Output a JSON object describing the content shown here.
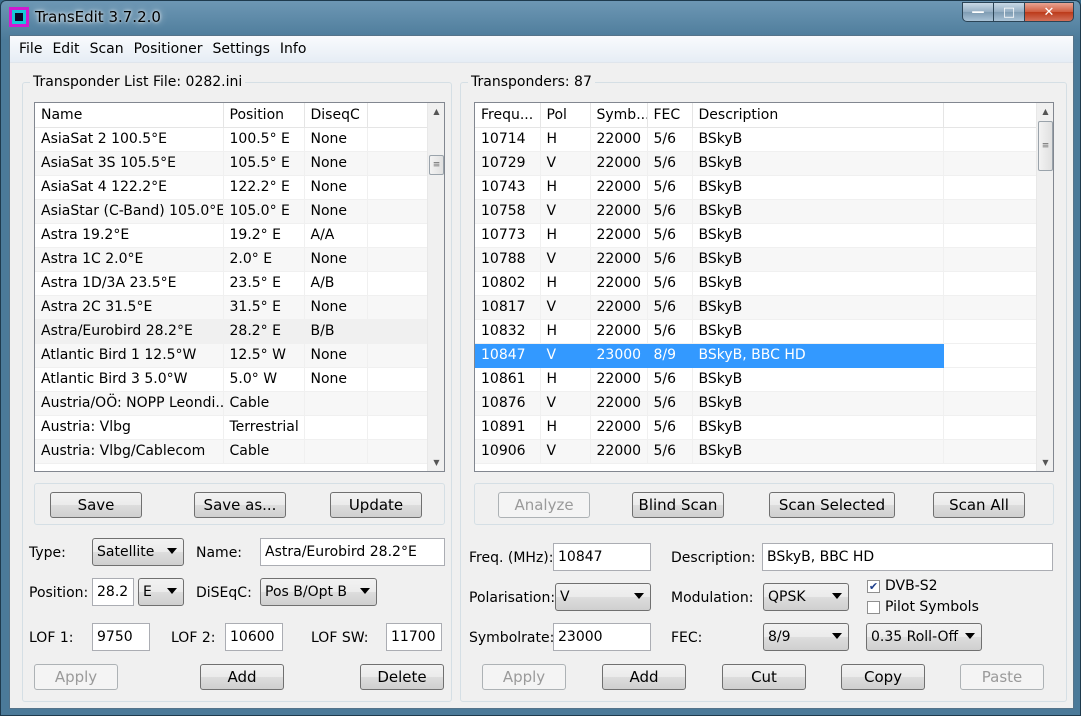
{
  "window": {
    "title": "TransEdit 3.7.2.0"
  },
  "menu": [
    "File",
    "Edit",
    "Scan",
    "Positioner",
    "Settings",
    "Info"
  ],
  "left": {
    "group_title": "Transponder List File:  0282.ini",
    "columns": [
      "Name",
      "Position",
      "DiseqC"
    ],
    "rows": [
      [
        "AsiaSat 2 100.5°E",
        "100.5° E",
        "None"
      ],
      [
        "AsiaSat 3S 105.5°E",
        "105.5° E",
        "None"
      ],
      [
        "AsiaSat 4 122.2°E",
        "122.2° E",
        "None"
      ],
      [
        "AsiaStar (C-Band) 105.0°E",
        "105.0° E",
        "None"
      ],
      [
        "Astra 19.2°E",
        "19.2° E",
        "A/A"
      ],
      [
        "Astra 1C 2.0°E",
        "2.0° E",
        "None"
      ],
      [
        "Astra 1D/3A 23.5°E",
        "23.5° E",
        "A/B"
      ],
      [
        "Astra 2C 31.5°E",
        "31.5° E",
        "None"
      ],
      [
        "Astra/Eurobird 28.2°E",
        "28.2° E",
        "B/B"
      ],
      [
        "Atlantic Bird 1 12.5°W",
        "12.5° W",
        "None"
      ],
      [
        "Atlantic Bird 3 5.0°W",
        "5.0° W",
        "None"
      ],
      [
        "Austria/OÖ: NOPP Leondi...",
        "Cable",
        ""
      ],
      [
        "Austria: Vlbg",
        "Terrestrial",
        ""
      ],
      [
        "Austria: Vlbg/Cablecom",
        "Cable",
        ""
      ]
    ],
    "buttons": {
      "save": "Save",
      "save_as": "Save as...",
      "update": "Update"
    },
    "form": {
      "type_label": "Type:",
      "type_value": "Satellite",
      "name_label": "Name:",
      "name_value": "Astra/Eurobird 28.2°E",
      "position_label": "Position:",
      "position_value": "28.2",
      "position_dir": "E",
      "diseqc_label": "DiSEqC:",
      "diseqc_value": "Pos B/Opt B",
      "lof1_label": "LOF 1:",
      "lof1_value": "9750",
      "lof2_label": "LOF 2:",
      "lof2_value": "10600",
      "lofsw_label": "LOF SW:",
      "lofsw_value": "11700"
    },
    "bottom_buttons": {
      "apply": "Apply",
      "add": "Add",
      "delete": "Delete"
    }
  },
  "right": {
    "group_title": "Transponders: 87",
    "columns": [
      "Frequ...",
      "Pol",
      "Symb...",
      "FEC",
      "Description"
    ],
    "rows": [
      [
        "10714",
        "H",
        "22000",
        "5/6",
        "BSkyB"
      ],
      [
        "10729",
        "V",
        "22000",
        "5/6",
        "BSkyB"
      ],
      [
        "10743",
        "H",
        "22000",
        "5/6",
        "BSkyB"
      ],
      [
        "10758",
        "V",
        "22000",
        "5/6",
        "BSkyB"
      ],
      [
        "10773",
        "H",
        "22000",
        "5/6",
        "BSkyB"
      ],
      [
        "10788",
        "V",
        "22000",
        "5/6",
        "BSkyB"
      ],
      [
        "10802",
        "H",
        "22000",
        "5/6",
        "BSkyB"
      ],
      [
        "10817",
        "V",
        "22000",
        "5/6",
        "BSkyB"
      ],
      [
        "10832",
        "H",
        "22000",
        "5/6",
        "BSkyB"
      ],
      [
        "10847",
        "V",
        "23000",
        "8/9",
        "BSkyB, BBC HD"
      ],
      [
        "10861",
        "H",
        "22000",
        "5/6",
        "BSkyB"
      ],
      [
        "10876",
        "V",
        "22000",
        "5/6",
        "BSkyB"
      ],
      [
        "10891",
        "H",
        "22000",
        "5/6",
        "BSkyB"
      ],
      [
        "10906",
        "V",
        "22000",
        "5/6",
        "BSkyB"
      ]
    ],
    "buttons": {
      "analyze": "Analyze",
      "blind_scan": "Blind Scan",
      "scan_selected": "Scan Selected",
      "scan_all": "Scan All"
    },
    "form": {
      "freq_label": "Freq. (MHz):",
      "freq_value": "10847",
      "desc_label": "Description:",
      "desc_value": "BSkyB, BBC HD",
      "pol_label": "Polarisation:",
      "pol_value": "V",
      "mod_label": "Modulation:",
      "mod_value": "QPSK",
      "dvbs2_label": "DVB-S2",
      "pilot_label": "Pilot Symbols",
      "sym_label": "Symbolrate:",
      "sym_value": "23000",
      "fec_label": "FEC:",
      "fec_value": "8/9",
      "rolloff_value": "0.35 Roll-Off"
    },
    "bottom_buttons": {
      "apply": "Apply",
      "add": "Add",
      "cut": "Cut",
      "copy": "Copy",
      "paste": "Paste"
    }
  }
}
